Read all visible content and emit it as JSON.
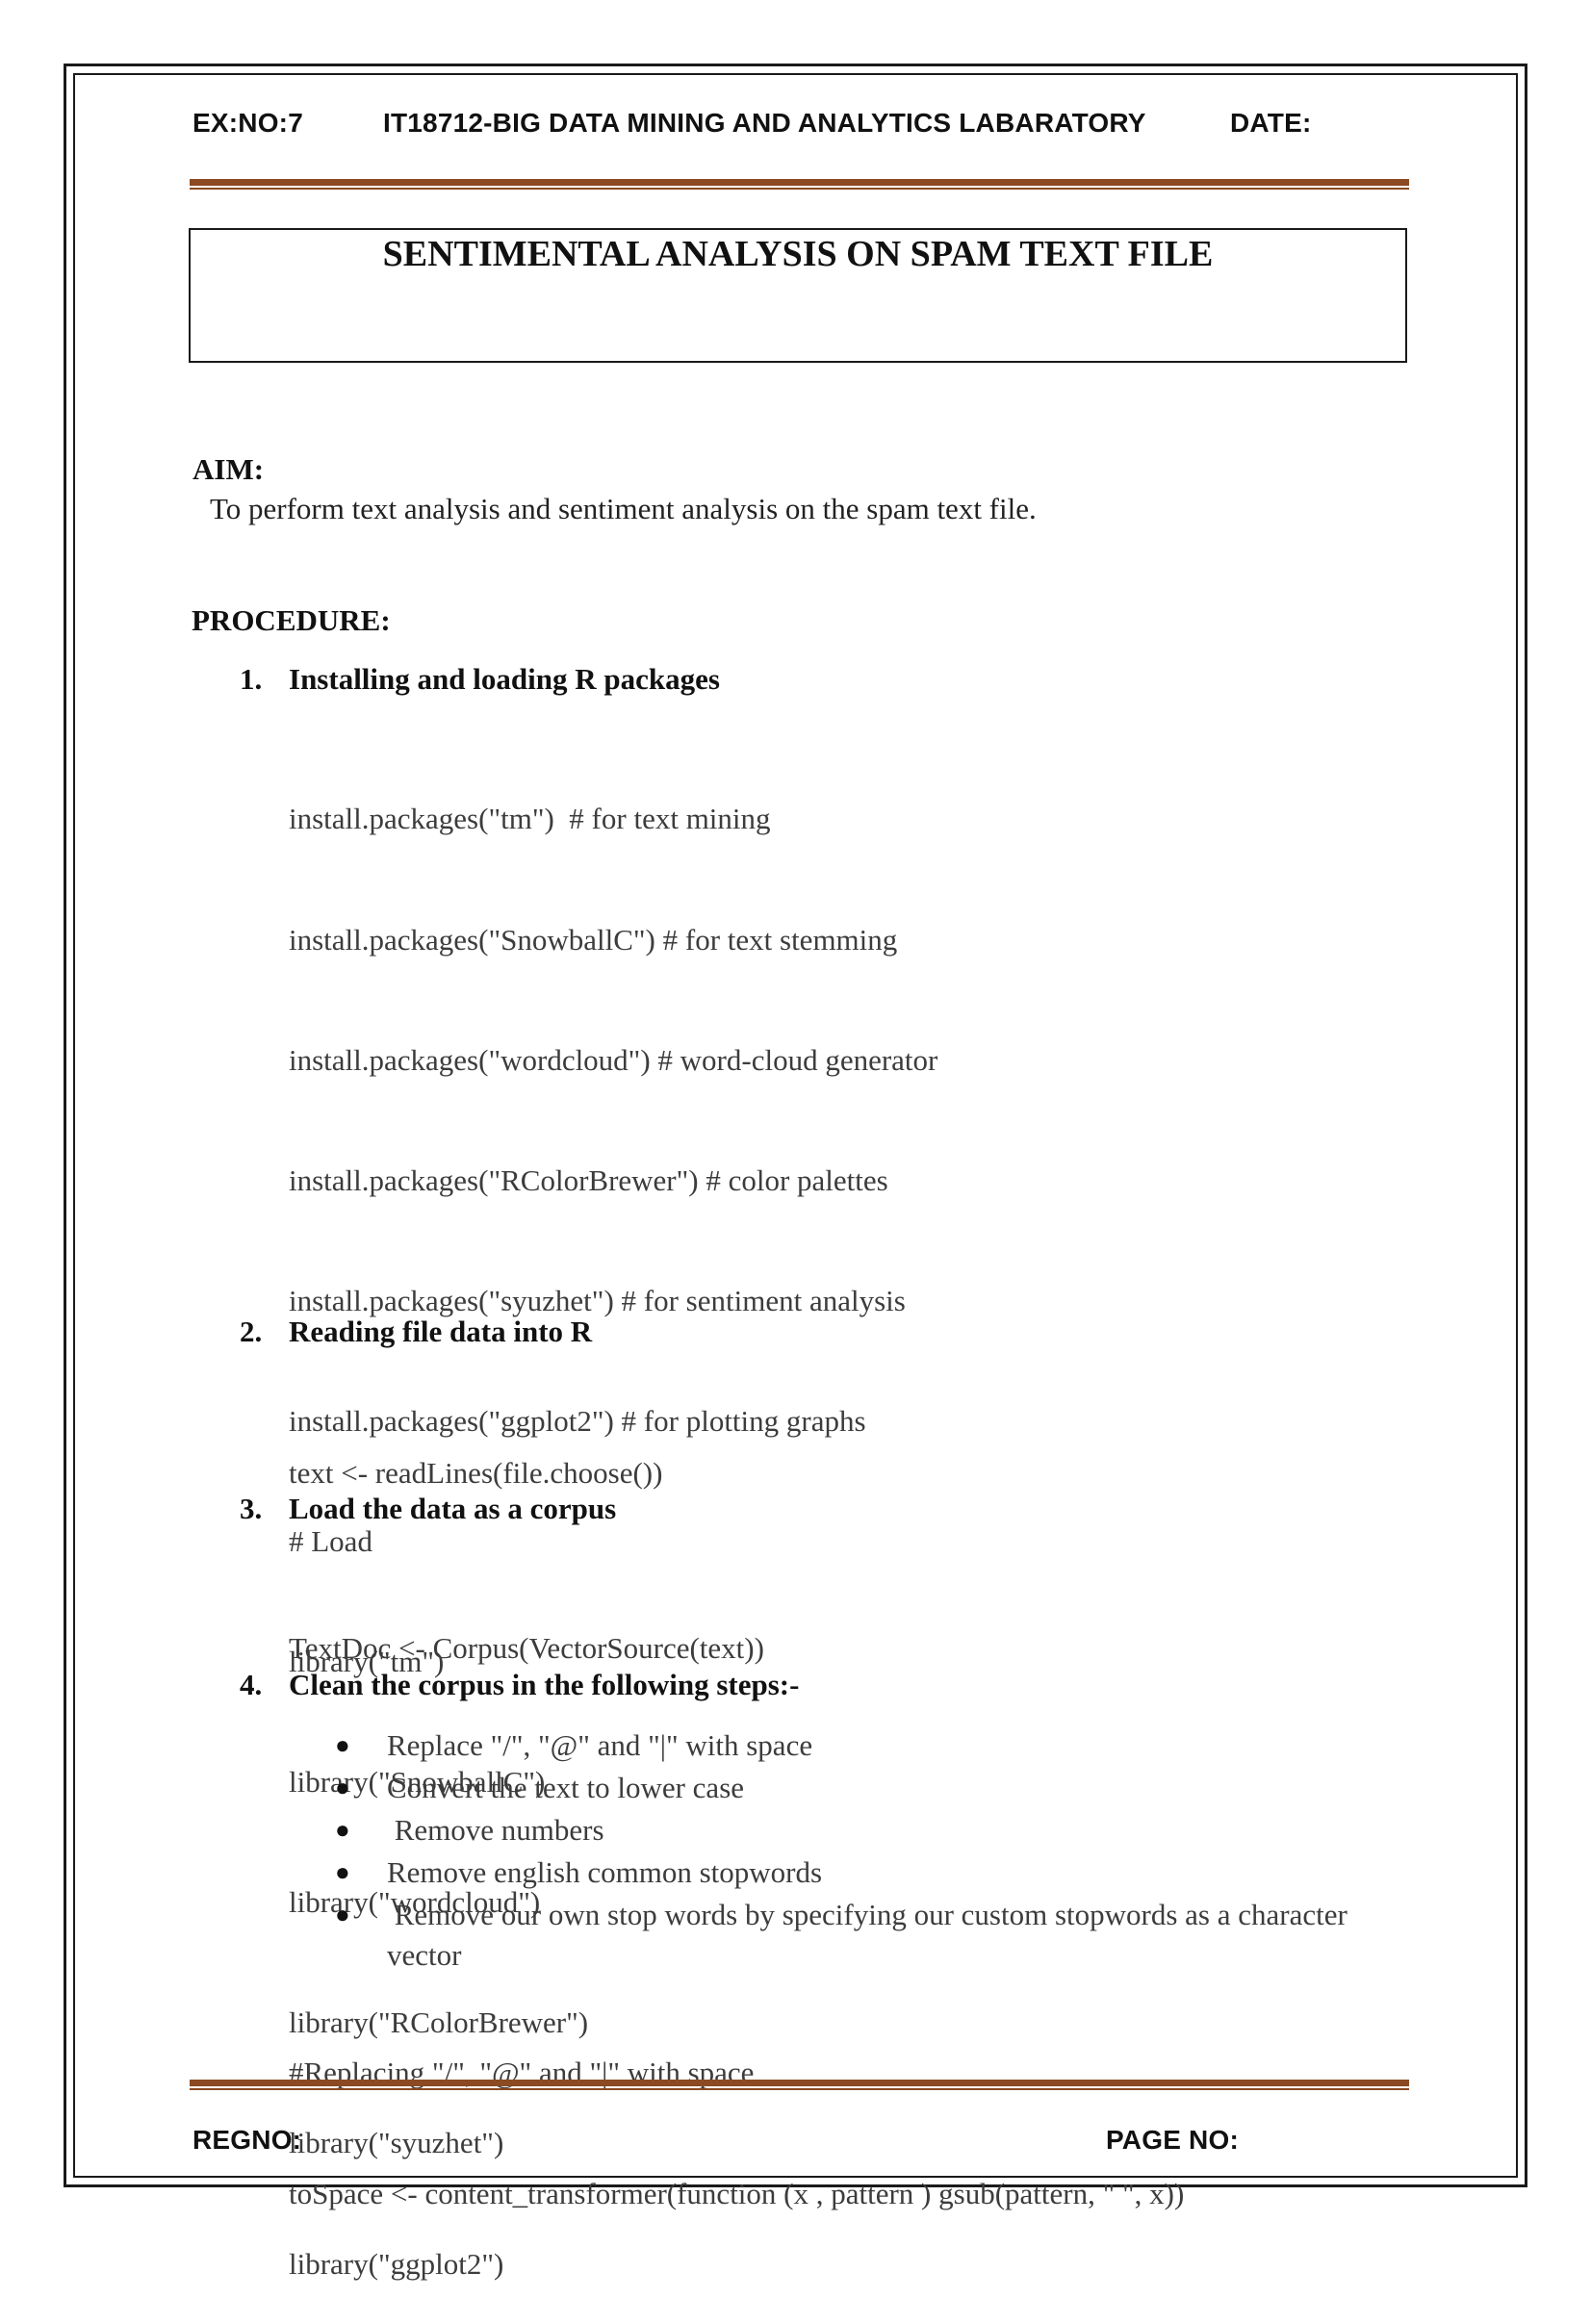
{
  "header": {
    "exno": "EX:NO:7",
    "course": "IT18712-BIG DATA MINING AND ANALYTICS LABARATORY",
    "date": "DATE:"
  },
  "title": "SENTIMENTAL ANALYSIS ON SPAM TEXT FILE",
  "aim": {
    "heading": "AIM:",
    "text": "To perform text analysis and sentiment analysis on the spam text file."
  },
  "procedure": {
    "heading": "PROCEDURE:",
    "steps": [
      {
        "number": "1.",
        "title": "Installing and loading R packages",
        "code": [
          "install.packages(\"tm\")  # for text mining",
          "install.packages(\"SnowballC\") # for text stemming",
          "install.packages(\"wordcloud\") # word-cloud generator",
          "install.packages(\"RColorBrewer\") # color palettes",
          "install.packages(\"syuzhet\") # for sentiment analysis",
          "install.packages(\"ggplot2\") # for plotting graphs",
          "# Load",
          "library(\"tm\")",
          "library(\"SnowballC\")",
          "library(\"wordcloud\")",
          "library(\"RColorBrewer\")",
          "library(\"syuzhet\")",
          "library(\"ggplot2\")"
        ]
      },
      {
        "number": "2.",
        "title": "Reading file data into R",
        "code": [
          "text <- readLines(file.choose())"
        ]
      },
      {
        "number": "3.",
        "title": "Load the data as a corpus",
        "code": [
          "TextDoc <- Corpus(VectorSource(text))"
        ]
      },
      {
        "number": "4.",
        "title": "Clean the corpus in the following steps:-",
        "bullets": [
          "Replace \"/\", \"@\" and \"|\" with space",
          "Convert the text to lower case",
          " Remove numbers",
          "Remove english common stopwords",
          " Remove our own stop words by specifying our custom stopwords as a character"
        ],
        "bullet_continuation": "vector",
        "code": [
          "#Replacing \"/\", \"@\" and \"|\" with space",
          "toSpace <- content_transformer(function (x , pattern ) gsub(pattern, \" \", x))"
        ]
      }
    ]
  },
  "footer": {
    "regno": "REGNO:",
    "pageno": "PAGE NO:"
  },
  "colors": {
    "rule": "#8b4a22",
    "text": "#111111",
    "code": "#3c3c3c"
  }
}
